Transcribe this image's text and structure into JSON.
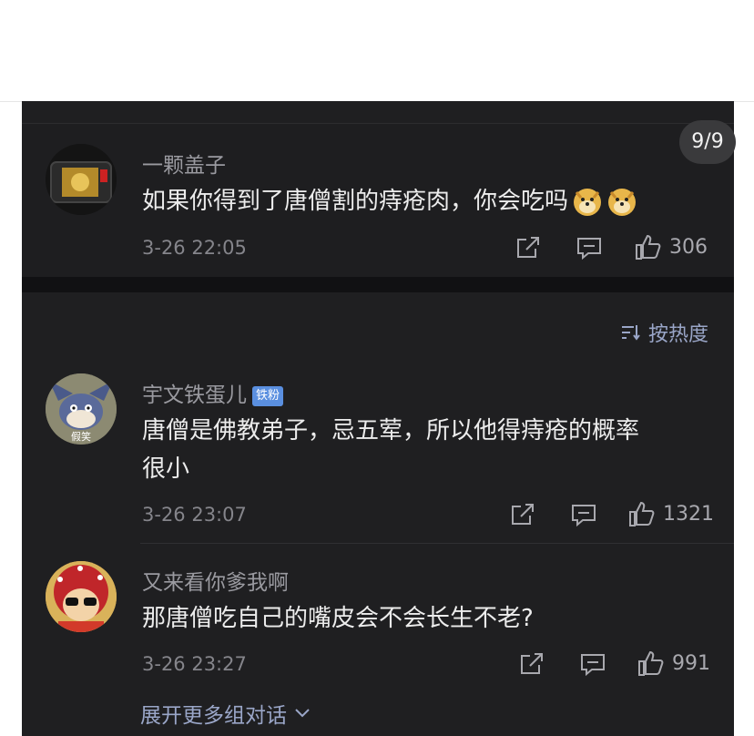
{
  "page_counter": "9/9",
  "post": {
    "user": "一颗盖子",
    "text": "如果你得到了唐僧割的痔疮肉，你会吃吗",
    "date": "3-26 22:05",
    "likes": "306",
    "emojis": [
      "doge-icon",
      "doge-icon"
    ]
  },
  "sort_label": "按热度",
  "comments": [
    {
      "user": "宇文铁蛋儿",
      "badge": "铁粉",
      "avatar_text": "假笑",
      "text_lines": [
        "唐僧是佛教弟子，忌五荤，所以他得痔疮的概率",
        "很小"
      ],
      "date": "3-26 23:07",
      "likes": "1321"
    },
    {
      "user": "又来看你爹我啊",
      "text_lines": [
        "那唐僧吃自己的嘴皮会不会长生不老?"
      ],
      "date": "3-26 23:27",
      "likes": "991"
    }
  ],
  "expand_label": "展开更多组对话",
  "colors": {
    "panel": "#1f1f21",
    "accent": "#9aa6c8",
    "badge": "#5a8fe0"
  }
}
